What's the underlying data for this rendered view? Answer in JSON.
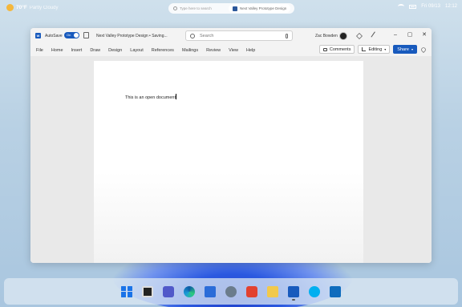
{
  "topbar": {
    "weather_temp": "70°F",
    "weather_condition": "Partly Cloudy",
    "search_placeholder": "Type here to search",
    "search_doc_title": "Next Valley Prototype Design",
    "date": "Fri 09/13",
    "time": "12:12"
  },
  "titlebar": {
    "autosave_label": "AutoSave",
    "autosave_state": "On",
    "document_title": "Next Valley Prototype Design • Saving...",
    "search_placeholder": "Search",
    "user_name": "Zac Bowden"
  },
  "menu": {
    "items": [
      "File",
      "Home",
      "Insert",
      "Draw",
      "Design",
      "Layout",
      "References",
      "Mailings",
      "Review",
      "View",
      "Help"
    ],
    "comments_label": "Comments",
    "editing_label": "Editing",
    "share_label": "Share"
  },
  "document": {
    "text": "This is an open document"
  },
  "taskbar": {
    "icons": [
      "start-icon",
      "tv-icon",
      "teams-icon",
      "edge-icon",
      "store-icon",
      "settings-icon",
      "office-icon",
      "file-explorer-icon",
      "word-icon",
      "skype-icon",
      "mail-icon"
    ]
  },
  "colors": {
    "word_blue": "#185abd",
    "desktop_bg": "#b9d1e4"
  }
}
